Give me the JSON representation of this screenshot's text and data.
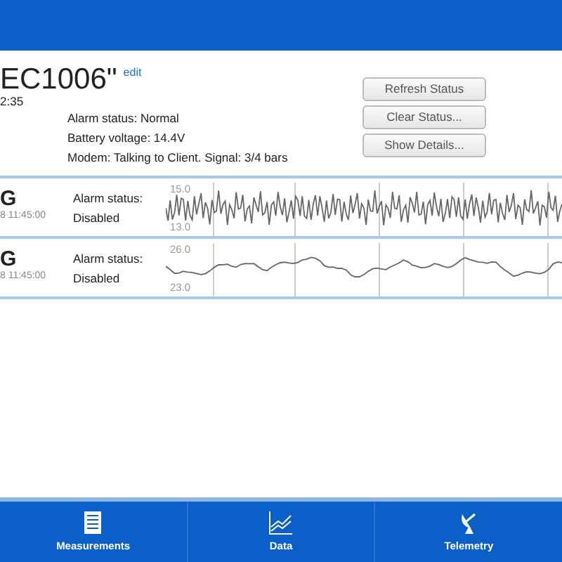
{
  "device": {
    "title": "EC1006\"",
    "edit_link": "edit",
    "time": "2:35",
    "status_lines": [
      "Alarm status: Normal",
      "Battery voltage: 14.4V",
      "Modem: Talking to Client. Signal: 3/4 bars"
    ],
    "buttons": [
      "Refresh Status",
      "Clear Status...",
      "Show Details..."
    ]
  },
  "sensors": [
    {
      "name": "G",
      "timestamp": "8 11:45:00",
      "alarm_label": "Alarm status:",
      "alarm_value": "Disabled",
      "y_top_label": "15.0",
      "y_bottom_label": "13.0",
      "kind": "noisy"
    },
    {
      "name": "G",
      "timestamp": "8 11:45:00",
      "alarm_label": "Alarm status:",
      "alarm_value": "Disabled",
      "y_top_label": "26.0",
      "y_bottom_label": "23.0",
      "kind": "smooth"
    }
  ],
  "tab_bar": [
    {
      "label": "Measurements",
      "kind": "list"
    },
    {
      "label": "Data",
      "kind": "chart"
    },
    {
      "label": "Telemetry",
      "kind": "dish"
    }
  ]
}
